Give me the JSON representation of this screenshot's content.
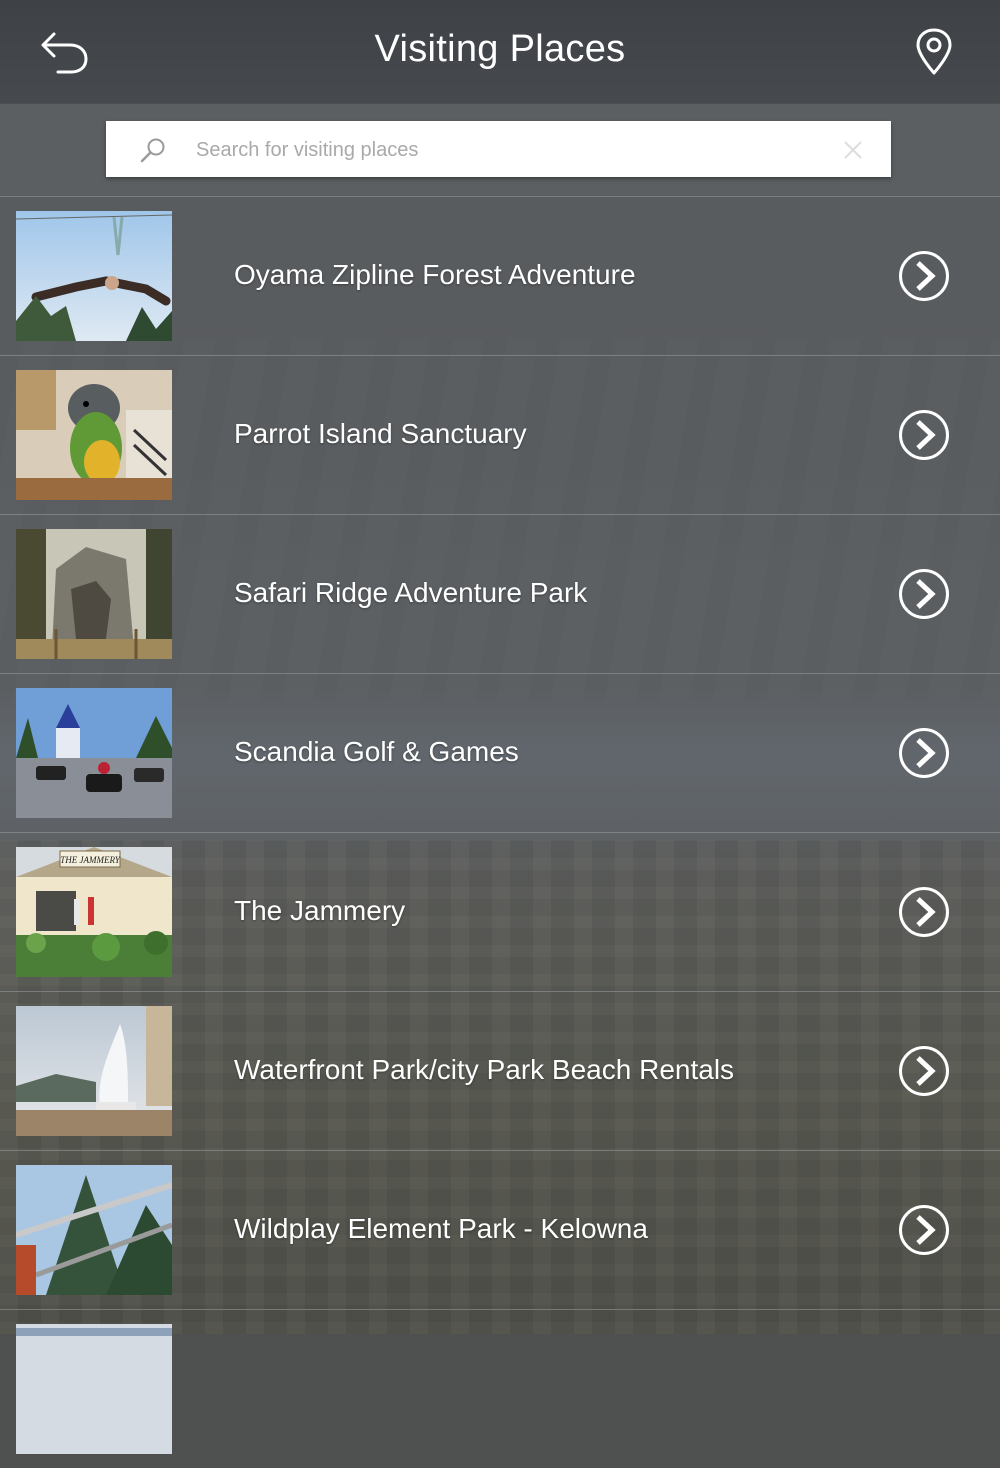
{
  "header": {
    "title": "Visiting Places",
    "back_icon": "back-arrow-icon",
    "map_icon": "map-pin-icon"
  },
  "search": {
    "placeholder": "Search for visiting places",
    "value": "",
    "search_icon": "search-icon",
    "clear_icon": "clear-icon"
  },
  "places": [
    {
      "name": "Oyama Zipline Forest Adventure",
      "thumb": "zipline-photo"
    },
    {
      "name": "Parrot Island Sanctuary",
      "thumb": "parrot-photo"
    },
    {
      "name": "Safari Ridge Adventure Park",
      "thumb": "safari-ridge-photo"
    },
    {
      "name": "Scandia Golf & Games",
      "thumb": "go-karts-photo"
    },
    {
      "name": "The Jammery",
      "thumb": "jammery-photo",
      "sign_text": "THE JAMMERY"
    },
    {
      "name": "Waterfront Park/city Park Beach Rentals",
      "thumb": "dolphin-statue-photo"
    },
    {
      "name": "Wildplay Element Park - Kelowna",
      "thumb": "wildplay-photo"
    }
  ],
  "colors": {
    "header_bg": "#41454a",
    "text": "#ffffff",
    "row_divider": "#969ca2"
  }
}
